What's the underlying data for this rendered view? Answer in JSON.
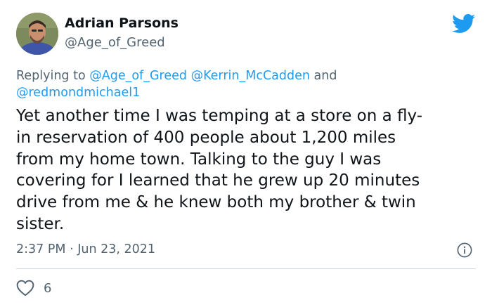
{
  "user": {
    "name": "Adrian Parsons",
    "handle": "@Age_of_Greed"
  },
  "reply": {
    "prefix": "Replying to",
    "mention_1": "@Age_of_Greed",
    "mention_2": "@Kerrin_McCadden",
    "conjunction": "and",
    "mention_3": "@redmondmichael1"
  },
  "tweet": {
    "lines": [
      "Yet another time I was temping at a store on a fly-",
      "in reservation of 400 people about 1,200 miles",
      "from my home town. Talking to the guy I was",
      "covering for I learned that he grew up 20 minutes",
      "drive from me & he knew both my brother & twin",
      "sister."
    ],
    "timestamp": "2:37 PM · Jun 23, 2021"
  },
  "engagement": {
    "likes": "6"
  },
  "icons": {
    "brand": "twitter-bird-icon",
    "info": "info-icon",
    "like": "heart-icon"
  },
  "colors": {
    "accent": "#1d9bf0",
    "text": "#0f1419",
    "secondary": "#536471",
    "divider": "#cfd9de"
  }
}
